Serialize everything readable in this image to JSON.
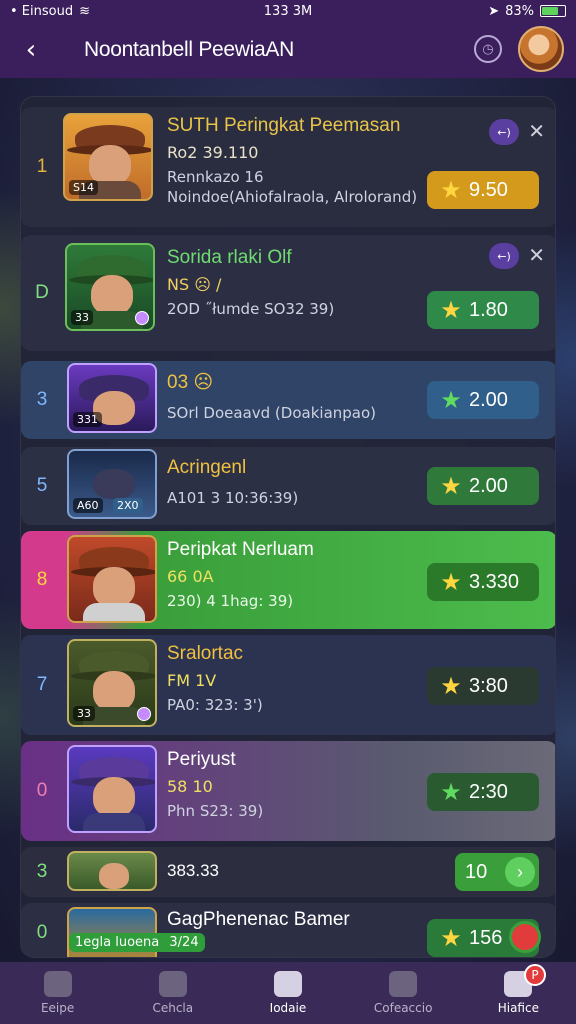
{
  "status_bar": {
    "carrier": "• Einsoud",
    "time": "133 3M",
    "battery": "83%",
    "battery_level": 0.83
  },
  "header": {
    "back_icon": "chevron-left-icon",
    "title": "Noontanbell PeewiaAN",
    "action_icon": "clock-icon",
    "avatar_icon": "avatar-icon"
  },
  "rows": [
    {
      "rank": "1",
      "name": "SUTH Peringkat Peemasan",
      "sub": "Ro2 39.110",
      "sub2": "Rennkazo 16",
      "sub3": "Noindoe(Ahiofalraola, Alrolorand)",
      "score": "9.50",
      "mini": "←)",
      "level": "S14"
    },
    {
      "rank": "D",
      "name": "Sorida rlaki Olf",
      "sub": "NS ☹ /",
      "sub2": "2OD ˝łumde SO32 39)",
      "score": "1.80",
      "mini": "←)",
      "level": "33"
    },
    {
      "rank": "3",
      "name": "03 ☹",
      "sub2": "SOrl Doeaavd (Doakianpao)",
      "score": "2.00",
      "level": "331"
    },
    {
      "rank": "5",
      "name": "Acringenl",
      "sub2": "A101 3 10:36:39)",
      "score": "2.00",
      "level": "A60",
      "extra": "2X0"
    },
    {
      "rank": "8",
      "name": "Peripkat Nerluam",
      "sub": "66 0A",
      "sub2": "230) 4 1hag: 39)",
      "score": "3.330"
    },
    {
      "rank": "7",
      "name": "Sralortac",
      "sub": "FM 1V",
      "sub2": "PA0: 323: 3')",
      "score": "3:80",
      "level": "33"
    },
    {
      "rank": "0",
      "name": "Periyust",
      "sub": "58 10",
      "sub2": "Phn S23: 39)",
      "score": "2:30"
    },
    {
      "rank": "3",
      "name": "383.33",
      "score": "10"
    },
    {
      "rank": "0",
      "name": "GagPhenenac Bamer",
      "sub2": "3/24",
      "tag": "1egla luoena",
      "score": "156"
    }
  ],
  "tabs": [
    {
      "label": "Eeipe",
      "icon": "shop-icon"
    },
    {
      "label": "Cehcla",
      "icon": "chest-icon"
    },
    {
      "label": "Iodaie",
      "icon": "home-icon"
    },
    {
      "label": "Cofeaccio",
      "icon": "gear-icon"
    },
    {
      "label": "Hiafice",
      "icon": "profile-icon"
    }
  ],
  "notif_badge": "P",
  "colors": {
    "accent": "#3a1f5c",
    "green": "#3a9e3a",
    "gold": "#d9a020",
    "pink": "#d33a8c",
    "purple_row": "#6a2f86"
  }
}
